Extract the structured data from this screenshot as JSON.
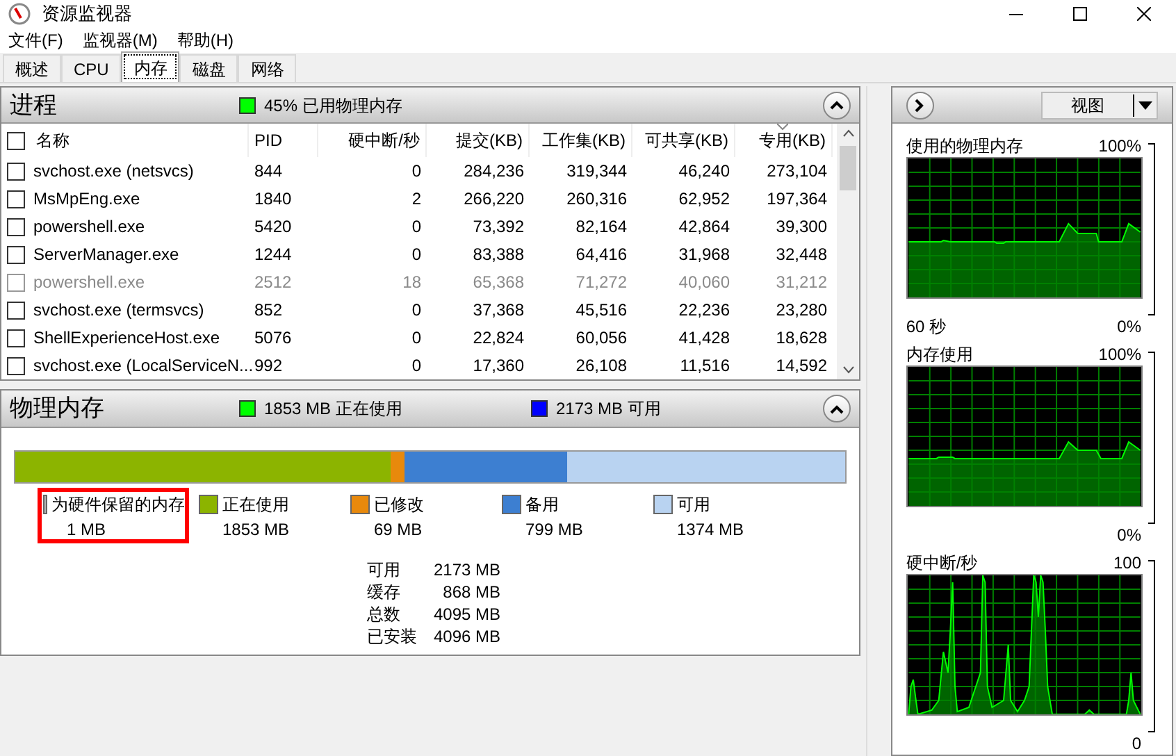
{
  "window": {
    "title": "资源监视器"
  },
  "menu": [
    "文件(F)",
    "监视器(M)",
    "帮助(H)"
  ],
  "tabs": [
    {
      "label": "概述",
      "selected": false
    },
    {
      "label": "CPU",
      "selected": false
    },
    {
      "label": "内存",
      "selected": true
    },
    {
      "label": "磁盘",
      "selected": false
    },
    {
      "label": "网络",
      "selected": false
    }
  ],
  "processes": {
    "title": "进程",
    "expanded": true,
    "indicator": {
      "text": "45% 已用物理内存",
      "color": "#00ff00"
    },
    "columns": [
      {
        "label": "名称",
        "sorted": false
      },
      {
        "label": "PID",
        "sorted": false
      },
      {
        "label": "硬中断/秒",
        "sorted": false
      },
      {
        "label": "提交(KB)",
        "sorted": false
      },
      {
        "label": "工作集(KB)",
        "sorted": false
      },
      {
        "label": "可共享(KB)",
        "sorted": false
      },
      {
        "label": "专用(KB)",
        "sorted": true
      }
    ],
    "rows": [
      {
        "checked": false,
        "terminated": false,
        "cells": [
          "svchost.exe (netsvcs)",
          "844",
          "0",
          "284,236",
          "319,344",
          "46,240",
          "273,104"
        ]
      },
      {
        "checked": false,
        "terminated": false,
        "cells": [
          "MsMpEng.exe",
          "1840",
          "2",
          "266,220",
          "260,316",
          "62,952",
          "197,364"
        ]
      },
      {
        "checked": false,
        "terminated": false,
        "cells": [
          "powershell.exe",
          "5420",
          "0",
          "73,392",
          "82,164",
          "42,864",
          "39,300"
        ]
      },
      {
        "checked": false,
        "terminated": false,
        "cells": [
          "ServerManager.exe",
          "1244",
          "0",
          "83,388",
          "64,416",
          "31,968",
          "32,448"
        ]
      },
      {
        "checked": false,
        "terminated": true,
        "cells": [
          "powershell.exe",
          "2512",
          "18",
          "65,368",
          "71,272",
          "40,060",
          "31,212"
        ]
      },
      {
        "checked": false,
        "terminated": false,
        "cells": [
          "svchost.exe (termsvcs)",
          "852",
          "0",
          "37,368",
          "45,516",
          "22,236",
          "23,280"
        ]
      },
      {
        "checked": false,
        "terminated": false,
        "cells": [
          "ShellExperienceHost.exe",
          "5076",
          "0",
          "22,824",
          "60,056",
          "41,428",
          "18,628"
        ]
      },
      {
        "checked": false,
        "terminated": false,
        "cells": [
          "svchost.exe (LocalServiceN...",
          "992",
          "0",
          "17,360",
          "26,108",
          "11,516",
          "14,592"
        ]
      }
    ]
  },
  "physical_memory": {
    "title": "物理内存",
    "expanded": true,
    "indicators": [
      {
        "text": "1853 MB 正在使用",
        "color": "#00ff00"
      },
      {
        "text": "2173 MB 可用",
        "color": "#0000ff"
      }
    ],
    "legend": [
      {
        "label": "为硬件保留的内存",
        "value": "1 MB",
        "color": "#b4b4b4",
        "highlighted": true
      },
      {
        "label": "正在使用",
        "value": "1853 MB",
        "color": "#8cb400",
        "highlighted": false
      },
      {
        "label": "已修改",
        "value": "69 MB",
        "color": "#e8890c",
        "highlighted": false
      },
      {
        "label": "备用",
        "value": "799 MB",
        "color": "#3d7fd1",
        "highlighted": false
      },
      {
        "label": "可用",
        "value": "1374 MB",
        "color": "#b9d3f1",
        "highlighted": false
      }
    ],
    "stats": [
      {
        "label": "可用",
        "value": "2173 MB"
      },
      {
        "label": "缓存",
        "value": "868 MB"
      },
      {
        "label": "总数",
        "value": "4095 MB"
      },
      {
        "label": "已安装",
        "value": "4096 MB"
      }
    ]
  },
  "side_panel": {
    "view_button": "视图",
    "graphs": [
      {
        "title": "使用的物理内存",
        "max": "100%",
        "min": "0%",
        "time": "60 秒"
      },
      {
        "title": "内存使用",
        "max": "100%",
        "min": "0%"
      },
      {
        "title": "硬中断/秒",
        "max": "100",
        "min": "0"
      }
    ]
  }
}
